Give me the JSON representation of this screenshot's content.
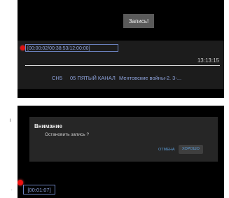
{
  "panel1": {
    "title_button": "Запись!",
    "record_time": "[00:00:02/00:38:53/12:00:00]",
    "clock": "13:13:15",
    "channel_short": "СН5",
    "channel_name": "05 ПЯТЫЙ КАНАЛ",
    "program": "Ментовские войны-2. 3-..."
  },
  "panel2": {
    "dialog": {
      "title": "Внимание",
      "message": "Остановить запись ?",
      "cancel": "ОТМЕНА",
      "ok": "ХОРОШО"
    },
    "timer": "[00:01:07]"
  },
  "side_marks": {
    "top": "l",
    "bottom": "."
  },
  "colors": {
    "accent_blue": "#8ea3dc",
    "record_red": "#d11111",
    "dialog_button_blue": "#5b9bd5"
  }
}
